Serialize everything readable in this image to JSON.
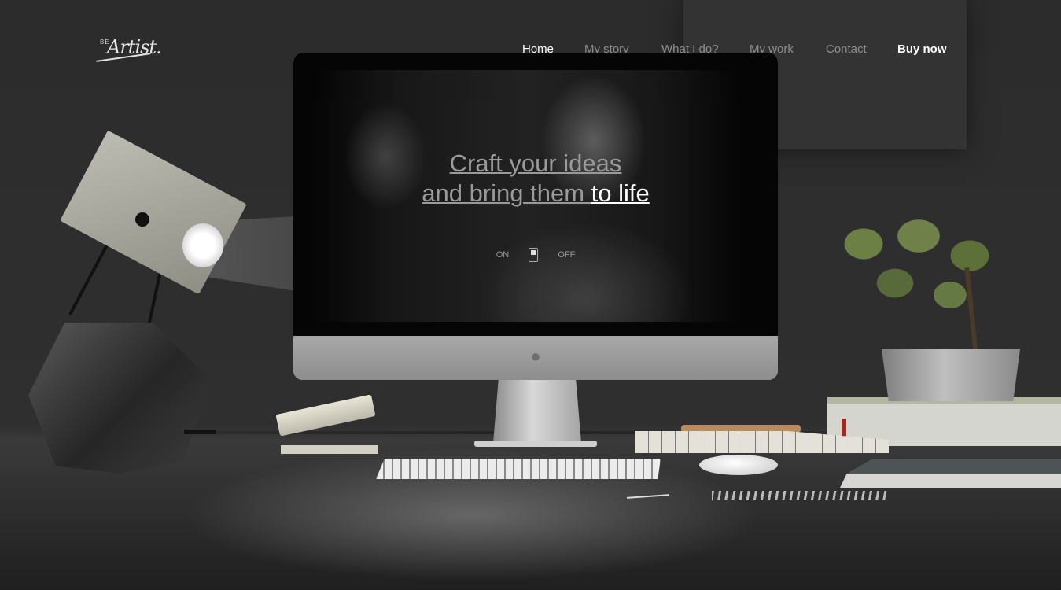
{
  "logo": {
    "small_text": "BE",
    "word": "Artist."
  },
  "nav": {
    "items": [
      {
        "label": "Home",
        "state": "active"
      },
      {
        "label": "My story",
        "state": "inactive"
      },
      {
        "label": "What I do?",
        "state": "inactive"
      },
      {
        "label": "My work",
        "state": "inactive"
      },
      {
        "label": "Contact",
        "state": "inactive"
      }
    ],
    "buy_label": "Buy now"
  },
  "hero": {
    "line1": "Craft your ideas",
    "line2_prefix": "and bring them ",
    "line2_highlight": "to life",
    "toggle_on": "ON",
    "toggle_off": "OFF"
  },
  "icons": {
    "monitor_logo": "apple-icon",
    "toggle": "switch-icon"
  },
  "colors": {
    "background": "#2b2b2b",
    "nav_active": "#ffffff",
    "nav_inactive": "#8e8e8e",
    "headline": "#9a9a9a",
    "headline_highlight": "#ffffff"
  }
}
